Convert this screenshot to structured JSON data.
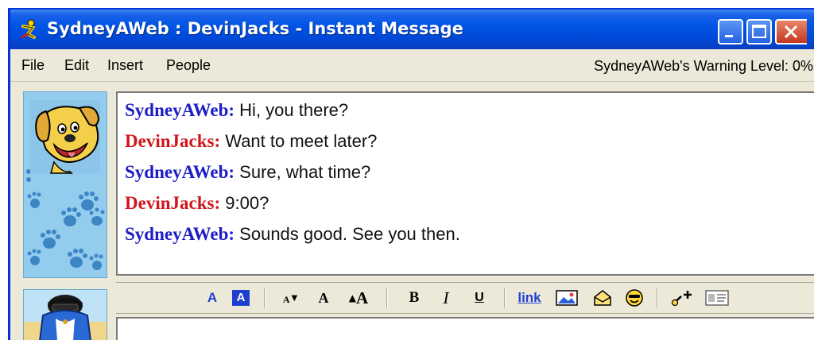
{
  "window": {
    "title": "SydneyAWeb : DevinJacks - Instant Message"
  },
  "menu": {
    "file": "File",
    "edit": "Edit",
    "insert": "Insert",
    "people": "People",
    "warning": "SydneyAWeb's Warning Level: 0%"
  },
  "conversation": {
    "messages": [
      {
        "sender": "SydneyAWeb:",
        "text": "Hi, you there?",
        "color": "#1d1ec4"
      },
      {
        "sender": "DevinJacks:",
        "text": "Want to meet later?",
        "color": "#d0161d"
      },
      {
        "sender": "SydneyAWeb:",
        "text": "Sure, what time?",
        "color": "#1d1ec4"
      },
      {
        "sender": "DevinJacks:",
        "text": "9:00?",
        "color": "#d0161d"
      },
      {
        "sender": "SydneyAWeb:",
        "text": "Sounds good. See you then.",
        "color": "#1d1ec4"
      }
    ]
  },
  "toolbar": {
    "text_color": "A",
    "bg_color": "A",
    "smaller_font": "A",
    "normal_font": "A",
    "larger_font": "A",
    "bold": "B",
    "italic": "I",
    "underline": "U",
    "link": "link"
  },
  "input": {
    "value": ""
  }
}
